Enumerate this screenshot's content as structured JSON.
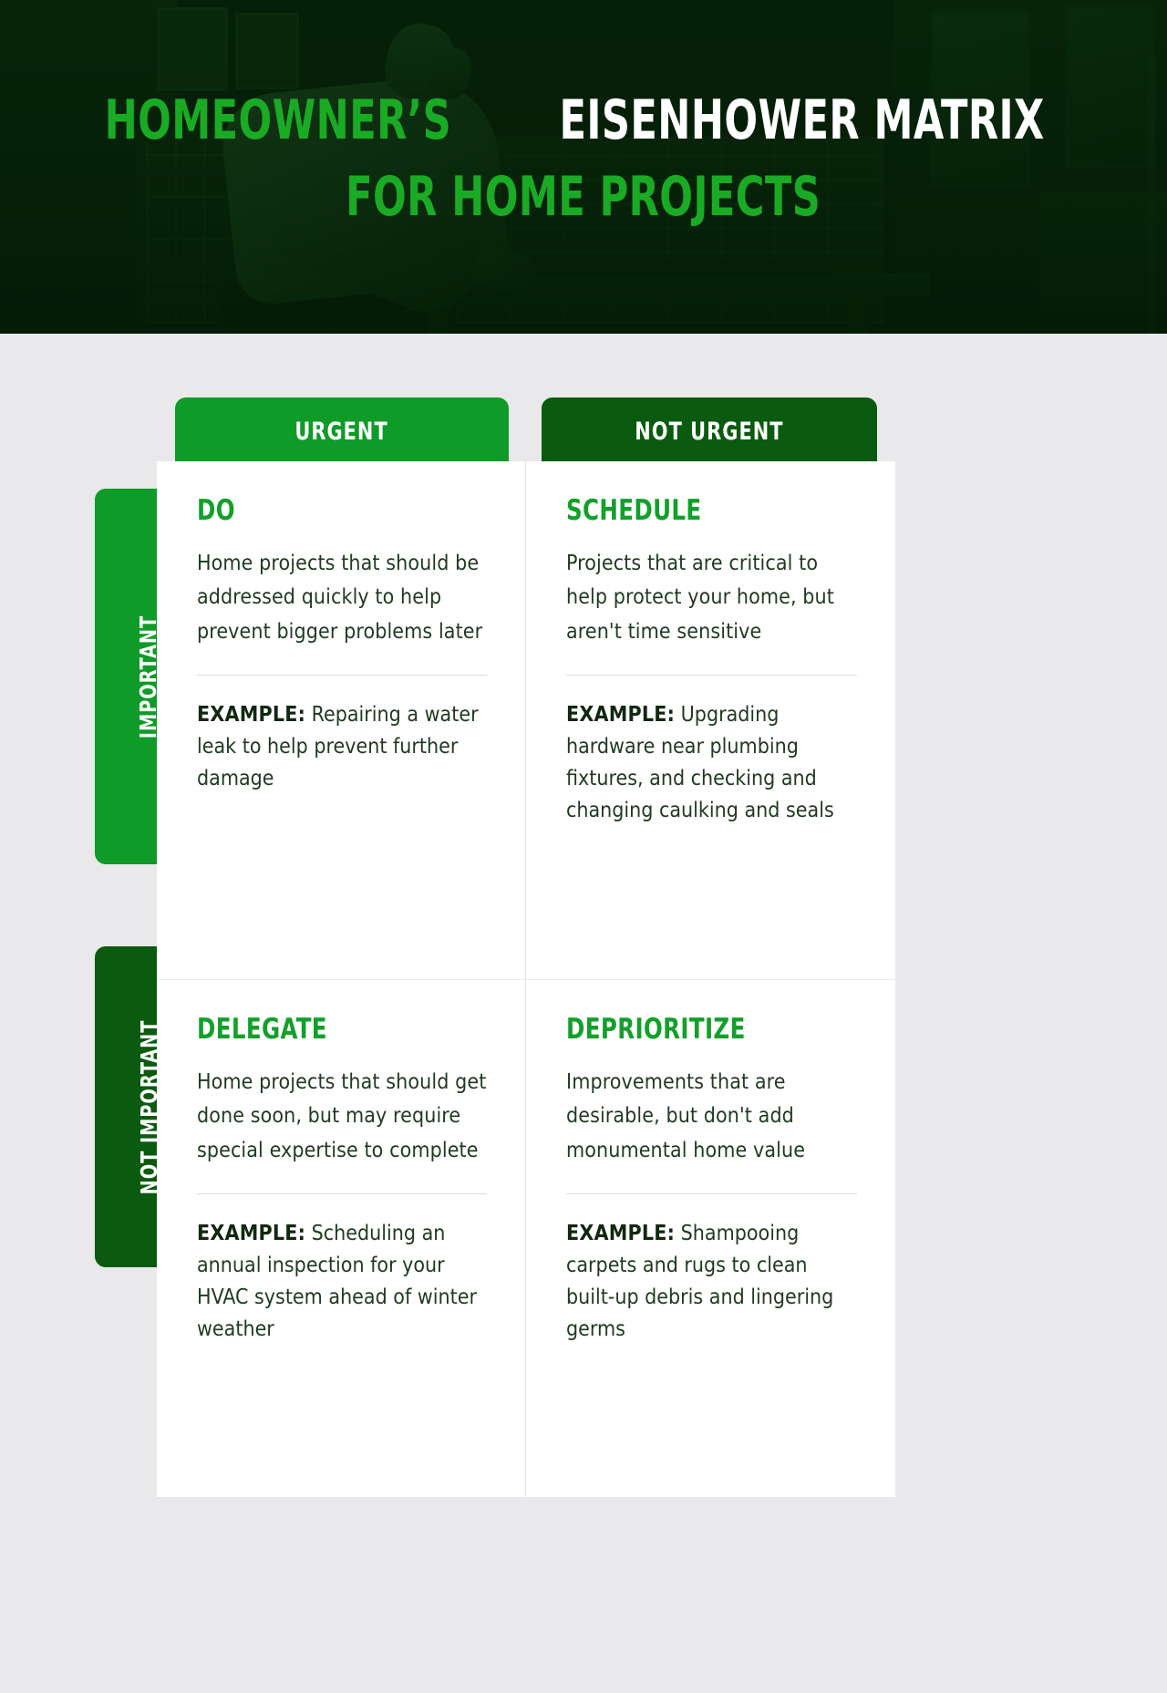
{
  "hero": {
    "title_line1_green": "HOMEOWNER’S",
    "title_line1_white": "EISENHOWER MATRIX",
    "title_line2": "FOR HOME PROJECTS",
    "image_alt": "man working at a workbench in a home with tools",
    "overlay_color": "#0a3d0e",
    "accent_green": "#1aab25",
    "title_white": "#ffffff"
  },
  "matrix": {
    "columns": [
      {
        "label": "URGENT",
        "color": "#0f9b28"
      },
      {
        "label": "NOT URGENT",
        "color": "#0a5a10"
      }
    ],
    "rows": [
      {
        "label": "IMPORTANT",
        "color": "#0f9b28"
      },
      {
        "label": "NOT IMPORTANT",
        "color": "#0a5a10"
      }
    ],
    "quadrants": [
      {
        "title": "DO",
        "body": "Home projects that should be addressed quickly to help prevent bigger problems later",
        "example_label": "EXAMPLE:",
        "example_text": " Repairing a water leak to help prevent further damage"
      },
      {
        "title": "SCHEDULE",
        "body": "Projects that are critical to help protect your home, but aren't time sensitive",
        "example_label": "EXAMPLE:",
        "example_text": " Upgrading hardware near plumbing fixtures, and checking and changing caulking and seals"
      },
      {
        "title": "DELEGATE",
        "body": "Home projects that should get done soon, but may require special expertise to complete",
        "example_label": "EXAMPLE:",
        "example_text": " Scheduling an annual inspection for your HVAC system ahead of winter weather"
      },
      {
        "title": "DEPRIORITIZE",
        "body": "Improvements that are desirable, but don't add monumental home value",
        "example_label": "EXAMPLE:",
        "example_text": " Shampooing carpets and rugs to clean built-up debris and lingering germs"
      }
    ],
    "title_color": "#12a02a",
    "body_color": "#1f3a20",
    "card_background": "#ffffff",
    "page_background": "#e9e9eb"
  }
}
